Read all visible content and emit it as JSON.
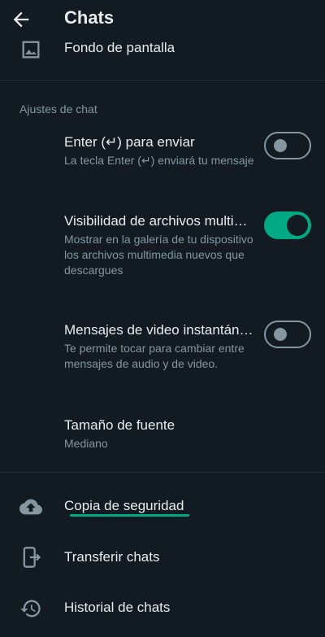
{
  "header": {
    "title": "Chats"
  },
  "wallpaper": {
    "label": "Fondo de pantalla"
  },
  "section": {
    "title": "Ajustes de chat"
  },
  "settings": [
    {
      "label": "Enter (↵) para enviar",
      "sub": "La tecla Enter (↵) enviará tu mensaje",
      "toggle": "off"
    },
    {
      "label": "Visibilidad de archivos multimedia",
      "sub": "Mostrar en la galería de tu dispositivo los archivos multimedia nuevos que descargues",
      "toggle": "on"
    },
    {
      "label": "Mensajes de video instantáneos",
      "sub": "Te permite tocar para cambiar entre mensajes de audio y de video.",
      "toggle": "off"
    },
    {
      "label": "Tamaño de fuente",
      "sub": "Mediano"
    }
  ],
  "bottom_items": [
    {
      "label": "Copia de seguridad",
      "icon": "cloud-upload-icon"
    },
    {
      "label": "Transferir chats",
      "icon": "phone-transfer-icon"
    },
    {
      "label": "Historial de chats",
      "icon": "history-icon"
    }
  ],
  "colors": {
    "accent": "#00a884",
    "background": "#111b21",
    "secondary_text": "#8696a0"
  }
}
